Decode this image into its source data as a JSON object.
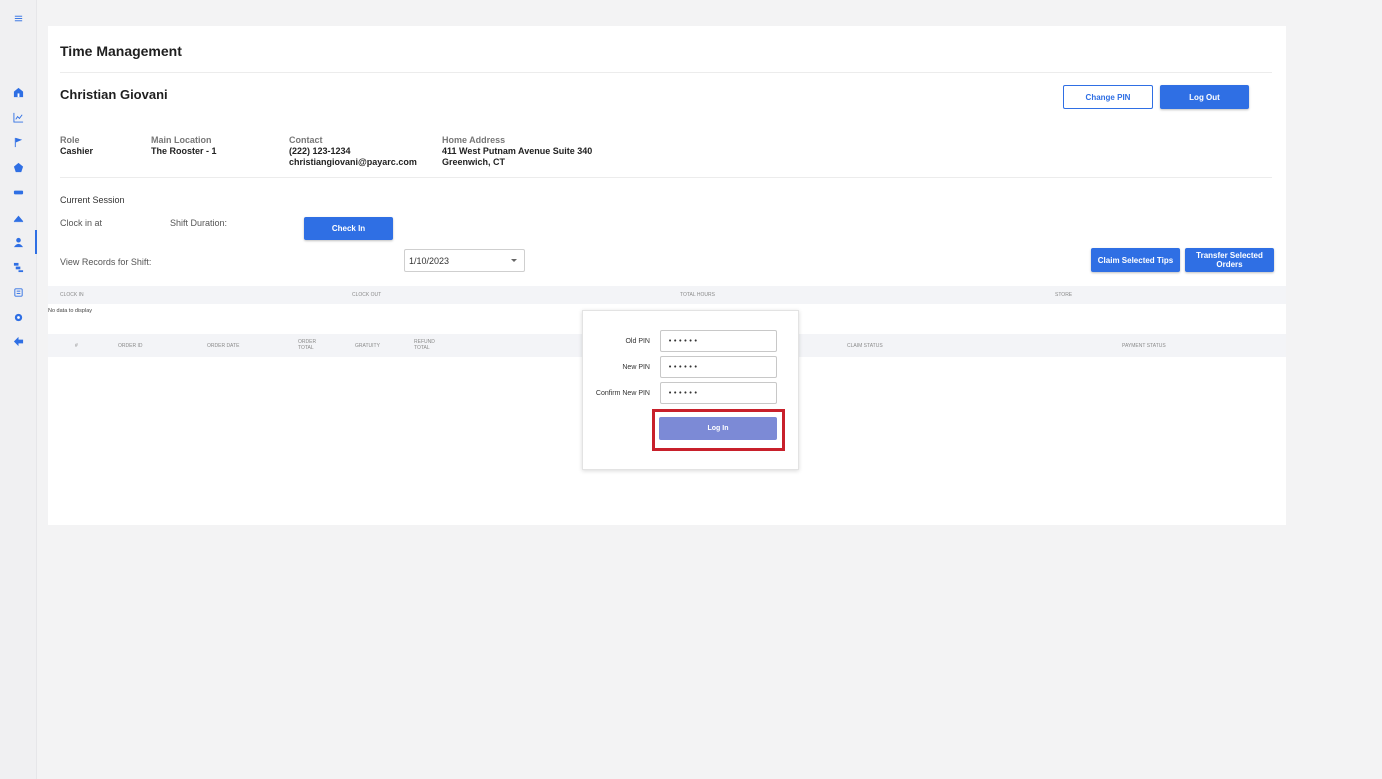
{
  "page": {
    "title": "Time Management"
  },
  "sidebar": {
    "icons": [
      "menu-icon",
      "home-icon",
      "chart-icon",
      "flag-icon",
      "tag-icon",
      "ticket-icon",
      "inventory-icon",
      "user-icon",
      "org-icon",
      "list-icon",
      "settings-icon",
      "back-arrow-icon"
    ]
  },
  "user": {
    "name": "Christian Giovani",
    "role_label": "Role",
    "role": "Cashier",
    "location_label": "Main Location",
    "location": "The Rooster - 1",
    "contact_label": "Contact",
    "phone": "(222) 123-1234",
    "email": "christiangiovani@payarc.com",
    "address_label": "Home Address",
    "address_line1": "411 West Putnam Avenue Suite 340",
    "address_line2": "Greenwich, CT"
  },
  "header_buttons": {
    "change_pin": "Change PIN",
    "log_out": "Log Out"
  },
  "session": {
    "title": "Current Session",
    "clock_in_label": "Clock in at",
    "shift_duration_label": "Shift Duration:",
    "check_in_button": "Check In",
    "view_records_label": "View Records for Shift:",
    "selected_date": "1/10/2023"
  },
  "actions": {
    "claim_tips": "Claim Selected Tips",
    "transfer_orders_line1": "Transfer Selected",
    "transfer_orders_line2": "Orders"
  },
  "shift_table": {
    "columns": [
      "CLOCK IN",
      "CLOCK OUT",
      "TOTAL HOURS",
      "STORE"
    ],
    "empty_text": "No data to display"
  },
  "orders_table": {
    "columns": [
      "#",
      "ORDER ID",
      "ORDER DATE",
      "ORDER TOTAL",
      "GRATUITY",
      "REFUND TOTAL",
      "CLAIM STATUS",
      "PAYMENT STATUS"
    ]
  },
  "pin_modal": {
    "old_pin_label": "Old PIN",
    "old_pin_value": "••••••",
    "new_pin_label": "New PIN",
    "new_pin_value": "••••••",
    "confirm_pin_label": "Confirm New PIN",
    "confirm_pin_value": "••••••",
    "submit_label": "Log In"
  },
  "colors": {
    "primary": "#2f6fe4",
    "highlight": "#c8202b",
    "submit": "#7c8ad6"
  }
}
